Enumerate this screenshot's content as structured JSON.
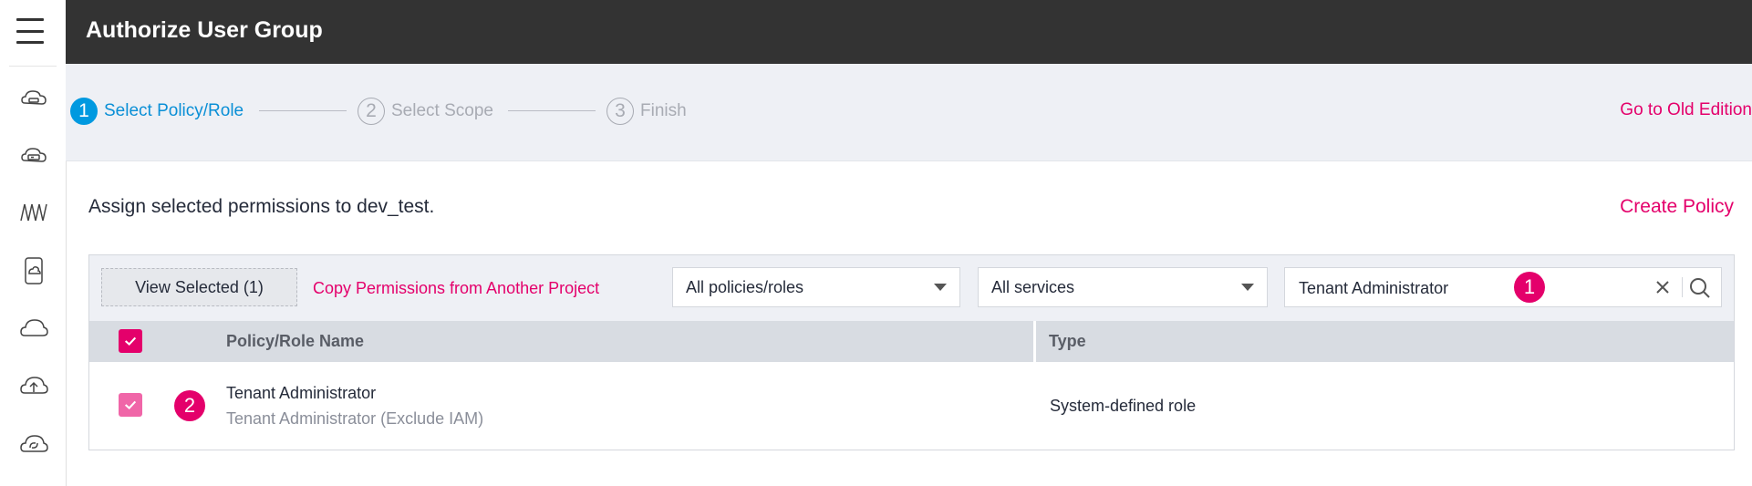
{
  "sidebar": {
    "icons": [
      "menu-icon",
      "cloud-server-icon",
      "storage-disk-icon",
      "network-icon",
      "phone-device-icon",
      "cloud-icon",
      "cloud-upload-icon",
      "cloud-sync-icon"
    ]
  },
  "header": {
    "title": "Authorize User Group"
  },
  "steps": [
    {
      "number": "1",
      "label": "Select Policy/Role",
      "active": true
    },
    {
      "number": "2",
      "label": "Select Scope",
      "active": false
    },
    {
      "number": "3",
      "label": "Finish",
      "active": false
    }
  ],
  "old_edition_link": "Go to Old Edition",
  "assign_text": "Assign selected permissions to dev_test.",
  "create_policy_link": "Create Policy",
  "toolbar": {
    "view_selected": "View Selected (1)",
    "copy_permissions": "Copy Permissions from Another Project",
    "policy_filter": "All policies/roles",
    "service_filter": "All services",
    "search_value": "Tenant Administrator",
    "search_badge": "1"
  },
  "table": {
    "headers": {
      "name": "Policy/Role Name",
      "type": "Type"
    },
    "rows": [
      {
        "badge": "2",
        "name": "Tenant Administrator",
        "description": "Tenant Administrator (Exclude IAM)",
        "type": "System-defined role",
        "checked": true
      }
    ]
  },
  "colors": {
    "accent": "#e4006b",
    "step_active": "#0099e0",
    "header_bg": "#333333"
  }
}
